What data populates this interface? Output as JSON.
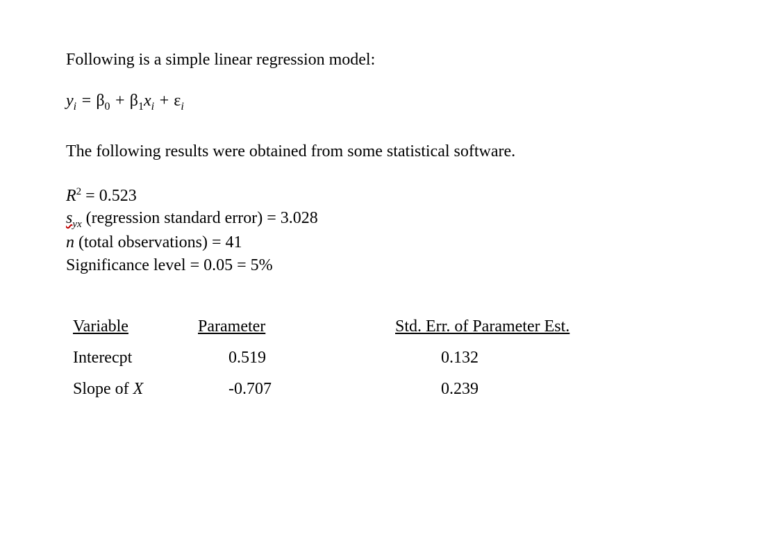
{
  "intro": "Following is a simple linear regression model:",
  "equation": {
    "y": "y",
    "i": "i",
    "eq": " = ",
    "beta": "β",
    "zero": "0",
    "plus": " + ",
    "one": "1",
    "x": "x",
    "eps": "ε"
  },
  "after_eq": "The following results were obtained from some statistical software.",
  "stats": {
    "r2_label_pre": "R",
    "r2_sup": "2",
    "r2_rest": " = 0.523",
    "syx_pre": "s",
    "syx_sub": "yx",
    "syx_rest": " (regression standard error) = 3.028",
    "n_pre": "n",
    "n_rest": " (total observations) = 41",
    "sig": "Significance level = 0.05 = 5%"
  },
  "table": {
    "h1": "Variable",
    "h2": "Parameter",
    "h3": "Std. Err. of Parameter Est.",
    "rows": [
      {
        "v": "Interecpt",
        "p": "0.519",
        "se": "0.132"
      },
      {
        "v_pre": "Slope of ",
        "v_x": "X",
        "p": "-0.707",
        "se": "0.239"
      }
    ]
  }
}
